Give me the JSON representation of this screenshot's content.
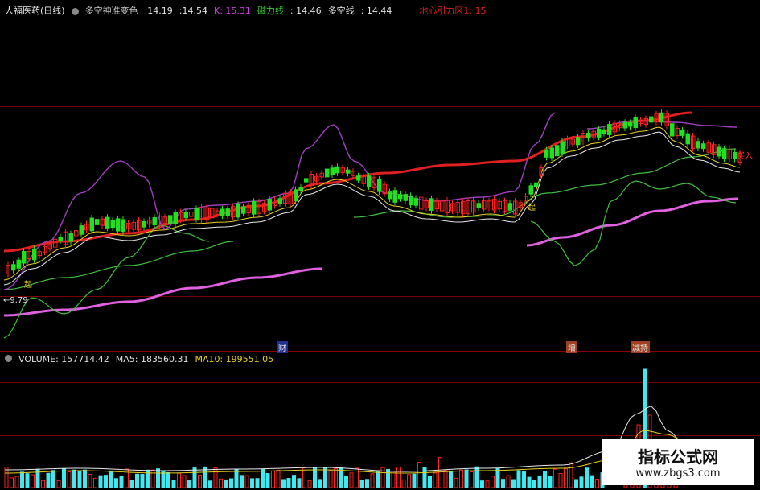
{
  "header": {
    "stock": "人福医药(日线)",
    "indicator1": "多空神准变色",
    "v1": ":14.19",
    "v2": ":14.54",
    "k_label": "K: 15.31",
    "support_label": "磁力线",
    "support_value": ": 14.46",
    "bull_bear_label": "多空线",
    "bull_bear_value": ": 14.44",
    "gravity": "地心引力区1: 15"
  },
  "annotations": {
    "low_price": "←9.79",
    "start1": "起",
    "start2": "起",
    "buy": "买入",
    "marker_cai": "财",
    "marker_zeng": "增",
    "marker_jigou": "减持"
  },
  "volume": {
    "label": "VOLUME: 157714.42",
    "ma5": "MA5: 183560.31",
    "ma10": "MA10: 199551.05"
  },
  "watermark": {
    "title": "指标公式网",
    "url": "www.zbgs3.com"
  },
  "colors": {
    "up": "#ff2020",
    "down": "#20e020",
    "ma_red": "#e02020",
    "ma_purple_band": "#a040c0",
    "ma_magenta": "#e060e0",
    "ma_green": "#40c040",
    "ma_white": "#e8e8e8",
    "ma_yellow": "#e8d020",
    "vol_cyan": "#40e8f0"
  }
}
